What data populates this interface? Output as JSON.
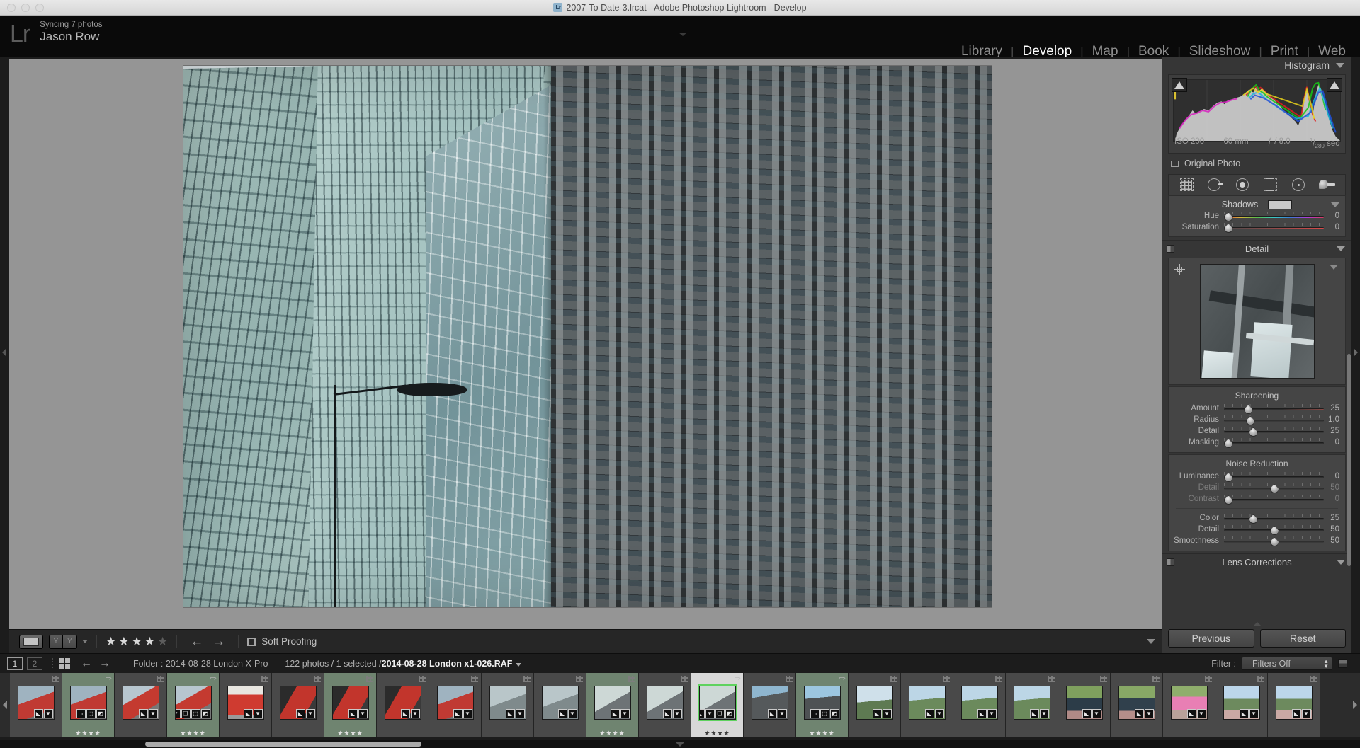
{
  "window": {
    "title": "2007-To Date-3.lrcat - Adobe Photoshop Lightroom - Develop",
    "doc_icon": "Lr"
  },
  "identity": {
    "logo": "Lr",
    "sync_status": "Syncing 7 photos",
    "user_name": "Jason Row"
  },
  "modules": [
    {
      "label": "Library",
      "active": false
    },
    {
      "label": "Develop",
      "active": true
    },
    {
      "label": "Map",
      "active": false
    },
    {
      "label": "Book",
      "active": false
    },
    {
      "label": "Slideshow",
      "active": false
    },
    {
      "label": "Print",
      "active": false
    },
    {
      "label": "Web",
      "active": false
    }
  ],
  "right_panel": {
    "histogram": {
      "title": "Histogram",
      "exif": {
        "iso": "ISO 200",
        "focal_length": "60 mm",
        "aperture": "ƒ / 8.0",
        "shutter_num": "1",
        "shutter_den": "280",
        "shutter_unit": "sec"
      },
      "original_photo_label": "Original Photo"
    },
    "tools": [
      {
        "name": "crop-overlay-tool"
      },
      {
        "name": "spot-removal-tool"
      },
      {
        "name": "red-eye-correction-tool"
      },
      {
        "name": "graduated-filter-tool"
      },
      {
        "name": "radial-filter-tool"
      },
      {
        "name": "adjustment-brush-tool"
      }
    ],
    "split_toning": {
      "title": "Shadows",
      "sliders": [
        {
          "label": "Hue",
          "value": "0",
          "pos": 4,
          "type": "hue"
        },
        {
          "label": "Saturation",
          "value": "0",
          "pos": 4,
          "type": "sat"
        }
      ]
    },
    "detail": {
      "title": "Detail",
      "sharpening": {
        "title": "Sharpening",
        "sliders": [
          {
            "label": "Amount",
            "value": "25",
            "pos": 24,
            "type": "amt",
            "dim": false
          },
          {
            "label": "Radius",
            "value": "1.0",
            "pos": 26,
            "type": "plain",
            "dim": false
          },
          {
            "label": "Detail",
            "value": "25",
            "pos": 29,
            "type": "plain",
            "dim": false
          },
          {
            "label": "Masking",
            "value": "0",
            "pos": 4,
            "type": "plain",
            "dim": false
          }
        ]
      },
      "noise_reduction": {
        "title": "Noise Reduction",
        "luminance_group": [
          {
            "label": "Luminance",
            "value": "0",
            "pos": 4,
            "type": "plain",
            "dim": false
          },
          {
            "label": "Detail",
            "value": "50",
            "pos": 50,
            "type": "plain",
            "dim": true
          },
          {
            "label": "Contrast",
            "value": "0",
            "pos": 4,
            "type": "plain",
            "dim": true
          }
        ],
        "color_group": [
          {
            "label": "Color",
            "value": "25",
            "pos": 29,
            "type": "plain",
            "dim": false
          },
          {
            "label": "Detail",
            "value": "50",
            "pos": 50,
            "type": "plain",
            "dim": false
          },
          {
            "label": "Smoothness",
            "value": "50",
            "pos": 50,
            "type": "plain",
            "dim": false
          }
        ]
      }
    },
    "lens_corrections": {
      "title": "Lens Corrections"
    },
    "buttons": {
      "previous": "Previous",
      "reset": "Reset"
    }
  },
  "toolbar": {
    "view_mode_icon": "loupe-view-icon",
    "before_after_icon": "before-after-icon",
    "rating": {
      "filled": 4,
      "total": 5
    },
    "prev_arrow": "←",
    "next_arrow": "→",
    "soft_proofing_label": "Soft Proofing",
    "soft_proofing_checked": false
  },
  "filmstrip_header": {
    "screen_1": "1",
    "screen_2": "2",
    "grid_icon": "grid-view-icon",
    "back_arrow": "←",
    "forward_arrow": "→",
    "folder_label": "Folder : 2014-08-28 London X-Pro",
    "photo_count": "122 photos / 1 selected /",
    "current_file": "2014-08-28 London x1-026.RAF",
    "filter_label": "Filter :",
    "filter_value": "Filters Off"
  },
  "filmstrip": {
    "thumbnails": [
      {
        "name": "thumb-1",
        "variant": "tv-bus",
        "state": "normal",
        "rating": "",
        "badges": [
          "tag",
          "comment"
        ],
        "flag": false,
        "cropmark": true
      },
      {
        "name": "thumb-2",
        "variant": "tv-bus",
        "state": "mark",
        "rating": "★★★★",
        "badges": [
          "crop",
          "dots",
          "adjust"
        ],
        "flag": true,
        "cropmark": false
      },
      {
        "name": "thumb-3",
        "variant": "tv-bus2",
        "state": "normal",
        "rating": "",
        "badges": [
          "tag",
          "comment"
        ],
        "flag": false,
        "cropmark": true
      },
      {
        "name": "thumb-4",
        "variant": "tv-bus2",
        "state": "mark",
        "rating": "★★★★",
        "badges": [
          "crop",
          "comment",
          "copy",
          "dots",
          "adjust"
        ],
        "flag": true,
        "cropmark": false
      },
      {
        "name": "thumb-5",
        "variant": "tv-bus3",
        "state": "normal",
        "rating": "",
        "badges": [
          "tag",
          "comment"
        ],
        "flag": false,
        "cropmark": true
      },
      {
        "name": "thumb-6",
        "variant": "tv-bus4",
        "state": "normal",
        "rating": "",
        "badges": [
          "tag",
          "comment"
        ],
        "flag": false,
        "cropmark": true
      },
      {
        "name": "thumb-7",
        "variant": "tv-bus4",
        "state": "mark",
        "rating": "★★★★",
        "badges": [
          "tag",
          "comment"
        ],
        "flag": false,
        "cropmark": true
      },
      {
        "name": "thumb-8",
        "variant": "tv-bus4",
        "state": "normal",
        "rating": "",
        "badges": [
          "tag",
          "comment"
        ],
        "flag": false,
        "cropmark": true
      },
      {
        "name": "thumb-9",
        "variant": "tv-bus",
        "state": "normal",
        "rating": "",
        "badges": [
          "tag",
          "comment"
        ],
        "flag": false,
        "cropmark": true
      },
      {
        "name": "thumb-10",
        "variant": "tv-build",
        "state": "normal",
        "rating": "",
        "badges": [
          "tag",
          "comment"
        ],
        "flag": false,
        "cropmark": true
      },
      {
        "name": "thumb-11",
        "variant": "tv-build",
        "state": "normal",
        "rating": "",
        "badges": [
          "tag",
          "comment"
        ],
        "flag": false,
        "cropmark": true
      },
      {
        "name": "thumb-12",
        "variant": "tv-fac",
        "state": "mark",
        "rating": "★★★★",
        "badges": [
          "tag",
          "comment"
        ],
        "flag": false,
        "cropmark": true
      },
      {
        "name": "thumb-13",
        "variant": "tv-fac",
        "state": "normal",
        "rating": "",
        "badges": [
          "tag",
          "comment"
        ],
        "flag": false,
        "cropmark": true
      },
      {
        "name": "thumb-14",
        "variant": "tv-fac",
        "state": "selected",
        "rating": "★★★★",
        "badges": [
          "tag",
          "comment",
          "copy",
          "adjust"
        ],
        "flag": true,
        "cropmark": false
      },
      {
        "name": "thumb-15",
        "variant": "tv-build2",
        "state": "normal",
        "rating": "",
        "badges": [
          "tag",
          "comment"
        ],
        "flag": false,
        "cropmark": true
      },
      {
        "name": "thumb-16",
        "variant": "tv-build3",
        "state": "mark",
        "rating": "★★★★",
        "badges": [
          "crop",
          "dots",
          "adjust"
        ],
        "flag": true,
        "cropmark": false
      },
      {
        "name": "thumb-17",
        "variant": "tv-lamp",
        "state": "normal",
        "rating": "",
        "badges": [
          "tag",
          "comment"
        ],
        "flag": false,
        "cropmark": true
      },
      {
        "name": "thumb-18",
        "variant": "tv-mem",
        "state": "normal",
        "rating": "",
        "badges": [
          "tag",
          "comment"
        ],
        "flag": false,
        "cropmark": true
      },
      {
        "name": "thumb-19",
        "variant": "tv-mem",
        "state": "normal",
        "rating": "",
        "badges": [
          "tag",
          "comment"
        ],
        "flag": false,
        "cropmark": true
      },
      {
        "name": "thumb-20",
        "variant": "tv-mem",
        "state": "normal",
        "rating": "",
        "badges": [
          "tag",
          "comment"
        ],
        "flag": false,
        "cropmark": true
      },
      {
        "name": "thumb-21",
        "variant": "tv-car",
        "state": "normal",
        "rating": "",
        "badges": [
          "tag",
          "comment"
        ],
        "flag": false,
        "cropmark": true
      },
      {
        "name": "thumb-22",
        "variant": "tv-car2",
        "state": "normal",
        "rating": "",
        "badges": [
          "tag",
          "comment"
        ],
        "flag": false,
        "cropmark": true
      },
      {
        "name": "thumb-23",
        "variant": "tv-pink",
        "state": "normal",
        "rating": "",
        "badges": [
          "tag",
          "comment"
        ],
        "flag": false,
        "cropmark": true
      },
      {
        "name": "thumb-24",
        "variant": "tv-mall",
        "state": "normal",
        "rating": "",
        "badges": [
          "tag",
          "comment"
        ],
        "flag": false,
        "cropmark": true
      },
      {
        "name": "thumb-25",
        "variant": "tv-mall",
        "state": "normal",
        "rating": "",
        "badges": [
          "tag",
          "comment"
        ],
        "flag": false,
        "cropmark": true
      }
    ]
  },
  "colors": {
    "panel_bg": "#363636",
    "canvas_bg": "#959595",
    "accent_green": "#5fd25f",
    "module_active": "#ffffff"
  }
}
